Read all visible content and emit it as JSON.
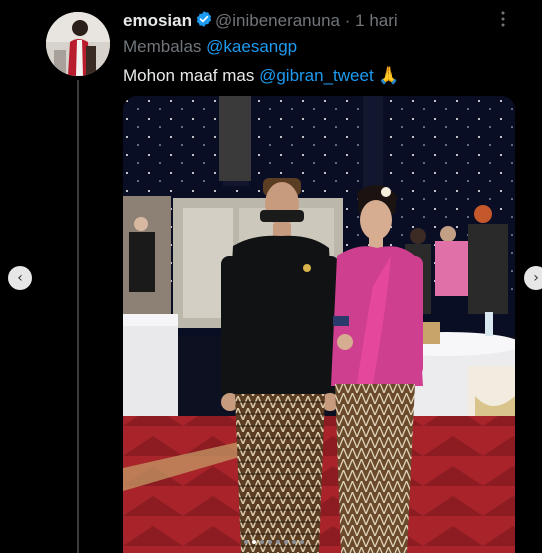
{
  "tweet": {
    "display_name": "emosian",
    "handle": "@inibeneranuna",
    "separator": "·",
    "time": "1 hari",
    "more_icon": "more-vertical-icon",
    "replying_prefix": "Membalas",
    "replying_to": "@kaesangp",
    "text_prefix": "Mohon maaf mas",
    "text_mention": "@gibran_tweet",
    "text_emoji": "🙏",
    "media_pages": 8,
    "media_active_page": 2
  },
  "colors": {
    "background": "#000000",
    "accent": "#1d9bf0",
    "muted": "#71767b",
    "text": "#e7e9ea"
  },
  "carousel": {
    "prev_icon": "chevron-left-icon",
    "next_icon": "chevron-right-icon"
  }
}
